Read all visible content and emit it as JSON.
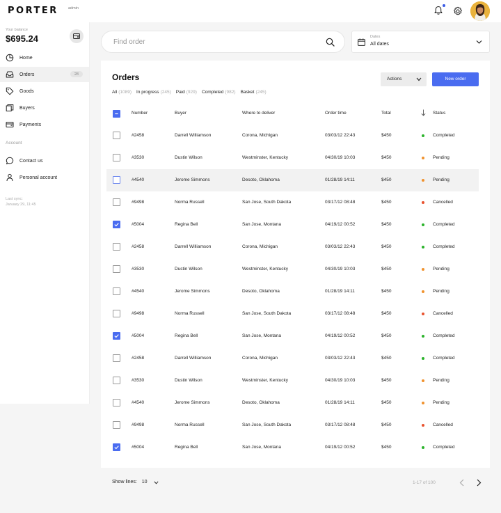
{
  "app": {
    "logo": "PORTER",
    "logo_sub": "admin"
  },
  "header": {
    "notification_icon": "bell-icon",
    "settings_icon": "gear-icon",
    "avatar": "user-avatar"
  },
  "sidebar": {
    "balance_label": "Your balance",
    "balance_value": "$695.24",
    "wallet_icon": "wallet-icon",
    "items": [
      {
        "label": "Home",
        "icon": "home-icon"
      },
      {
        "label": "Orders",
        "icon": "inbox-icon",
        "badge": "28",
        "active": true
      },
      {
        "label": "Goods",
        "icon": "tag-icon"
      },
      {
        "label": "Buyers",
        "icon": "buyers-icon"
      },
      {
        "label": "Payments",
        "icon": "card-icon"
      }
    ],
    "account_section": "Account",
    "account_items": [
      {
        "label": "Contact us",
        "icon": "chat-icon"
      },
      {
        "label": "Personal account",
        "icon": "user-icon"
      }
    ],
    "sync_label": "Last sync:",
    "sync_value": "January 29, 11:45"
  },
  "search": {
    "placeholder": "Find order"
  },
  "dates": {
    "label": "Dates",
    "value": "All dates"
  },
  "orders": {
    "title": "Orders",
    "actions_label": "Actions",
    "new_order_label": "New order",
    "filters": [
      {
        "label": "All",
        "count": "(1089)"
      },
      {
        "label": "In progress",
        "count": "(245)"
      },
      {
        "label": "Paid",
        "count": "(929)"
      },
      {
        "label": "Completed",
        "count": "(982)"
      },
      {
        "label": "Basket",
        "count": "(245)"
      }
    ],
    "columns": {
      "number": "Number",
      "buyer": "Buyer",
      "where": "Where to deliver",
      "time": "Order time",
      "total": "Total",
      "status": "Status"
    },
    "status_colors": {
      "Completed": "#2bb32b",
      "Pending": "#f0922e",
      "Cancelled": "#e8522e"
    },
    "rows": [
      {
        "number": "#2458",
        "buyer": "Darrell Williamson",
        "where": "Corona, Michigan",
        "time": "03/03/12 22:43",
        "total": "$450",
        "status": "Completed",
        "checked": false
      },
      {
        "number": "#3530",
        "buyer": "Dustin Wilson",
        "where": "Westminster, Kentucky",
        "time": "04/30/19 10:03",
        "total": "$450",
        "status": "Pending",
        "checked": false
      },
      {
        "number": "#4540",
        "buyer": "Jerome Simmons",
        "where": "Desoto, Oklahoma",
        "time": "01/28/19 14:11",
        "total": "$450",
        "status": "Pending",
        "checked": false,
        "highlighted": true
      },
      {
        "number": "#9498",
        "buyer": "Norma Russell",
        "where": "San Jose, South Dakota",
        "time": "03/17/12 08:48",
        "total": "$450",
        "status": "Cancelled",
        "checked": false
      },
      {
        "number": "#5004",
        "buyer": "Regina Bell",
        "where": "San Jose, Montana",
        "time": "04/19/12 00:52",
        "total": "$450",
        "status": "Completed",
        "checked": true
      },
      {
        "number": "#2458",
        "buyer": "Darrell Williamson",
        "where": "Corona, Michigan",
        "time": "03/03/12 22:43",
        "total": "$450",
        "status": "Completed",
        "checked": false
      },
      {
        "number": "#3530",
        "buyer": "Dustin Wilson",
        "where": "Westminster, Kentucky",
        "time": "04/30/19 10:03",
        "total": "$450",
        "status": "Pending",
        "checked": false
      },
      {
        "number": "#4540",
        "buyer": "Jerome Simmons",
        "where": "Desoto, Oklahoma",
        "time": "01/28/19 14:11",
        "total": "$450",
        "status": "Pending",
        "checked": false
      },
      {
        "number": "#9498",
        "buyer": "Norma Russell",
        "where": "San Jose, South Dakota",
        "time": "03/17/12 08:48",
        "total": "$450",
        "status": "Cancelled",
        "checked": false
      },
      {
        "number": "#5004",
        "buyer": "Regina Bell",
        "where": "San Jose, Montana",
        "time": "04/19/12 00:52",
        "total": "$450",
        "status": "Completed",
        "checked": true
      },
      {
        "number": "#2458",
        "buyer": "Darrell Williamson",
        "where": "Corona, Michigan",
        "time": "03/03/12 22:43",
        "total": "$450",
        "status": "Completed",
        "checked": false
      },
      {
        "number": "#3530",
        "buyer": "Dustin Wilson",
        "where": "Westminster, Kentucky",
        "time": "04/30/19 10:03",
        "total": "$450",
        "status": "Pending",
        "checked": false
      },
      {
        "number": "#4540",
        "buyer": "Jerome Simmons",
        "where": "Desoto, Oklahoma",
        "time": "01/28/19 14:11",
        "total": "$450",
        "status": "Pending",
        "checked": false
      },
      {
        "number": "#9498",
        "buyer": "Norma Russell",
        "where": "San Jose, South Dakota",
        "time": "03/17/12 08:48",
        "total": "$450",
        "status": "Cancelled",
        "checked": false
      },
      {
        "number": "#5004",
        "buyer": "Regina Bell",
        "where": "San Jose, Montana",
        "time": "04/19/12 00:52",
        "total": "$450",
        "status": "Completed",
        "checked": true
      }
    ]
  },
  "footer": {
    "show_lines_label": "Show lines:",
    "show_lines_value": "10",
    "pager_info": "1-17 of 100"
  }
}
